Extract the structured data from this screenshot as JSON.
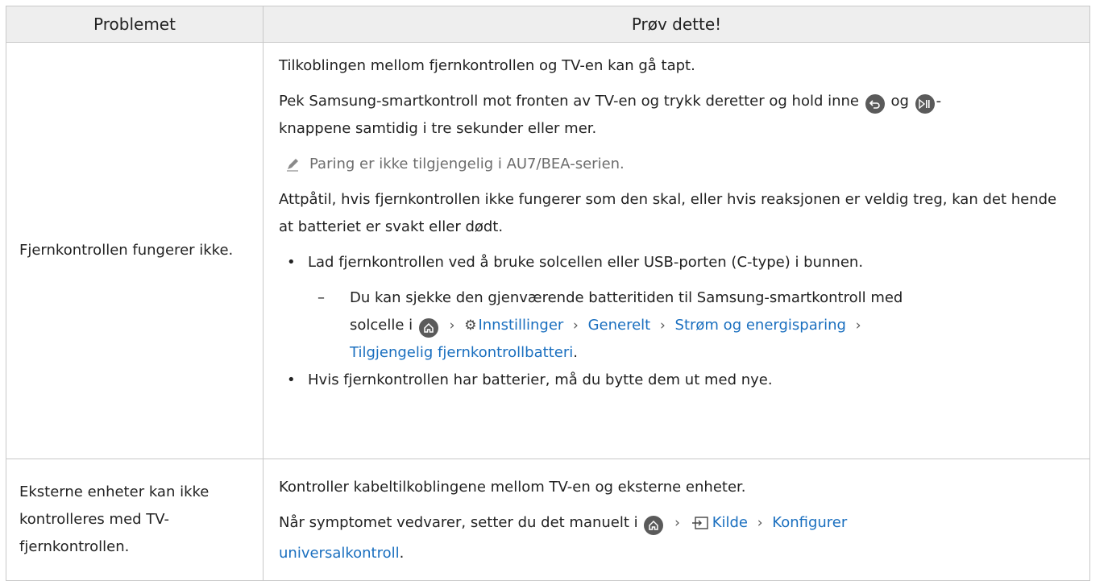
{
  "header": {
    "col1": "Problemet",
    "col2": "Prøv dette!"
  },
  "row1": {
    "problem": "Fjernkontrollen fungerer ikke.",
    "p1": "Tilkoblingen mellom fjernkontrollen og TV-en kan gå tapt.",
    "p2a": "Pek Samsung-smartkontroll mot fronten av TV-en og trykk deretter og hold inne",
    "p2b": "og",
    "p2c": "-",
    "p2d": "knappene samtidig i tre sekunder eller mer.",
    "note": "Paring er ikke tilgjengelig i AU7/BEA-serien.",
    "p3": "Attpåtil, hvis fjernkontrollen ikke fungerer som den skal, eller hvis reaksjonen er veldig treg, kan det hende at batteriet er svakt eller dødt.",
    "bullet1": "Lad fjernkontrollen ved å bruke solcellen eller USB-porten (C-type) i bunnen.",
    "dash1a": "Du kan sjekke den gjenværende batteritiden til Samsung-smartkontroll med",
    "dash1b": "solcelle i",
    "path": [
      "Innstillinger",
      "Generelt",
      "Strøm og energisparing",
      "Tilgjengelig fjernkontrollbatteri"
    ],
    "period": ".",
    "bullet2": "Hvis fjernkontrollen har batterier, må du bytte dem ut med nye.",
    "bullet_char": "•",
    "dash_char": "–"
  },
  "row2": {
    "problem": "Eksterne enheter kan ikke kontrolleres med TV-fjernkontrollen.",
    "p1": "Kontroller kabeltilkoblingene mellom TV-en og eksterne enheter.",
    "p2a": "Når symptomet vedvarer, setter du det manuelt i",
    "path": [
      "Kilde",
      "Konfigurer",
      "universalkontroll"
    ],
    "period": "."
  },
  "icons": {
    "back": "back-button-icon",
    "playpause": "play-pause-button-icon",
    "home": "home-icon",
    "gear": "settings-gear-icon",
    "source": "source-input-icon",
    "chevron": "chevron-right-icon",
    "pencil": "note-pencil-icon"
  },
  "colors": {
    "link": "#1a6fbf",
    "header_bg": "#eeeeee",
    "border": "#c8c8c8",
    "note": "#6d6d6d"
  }
}
